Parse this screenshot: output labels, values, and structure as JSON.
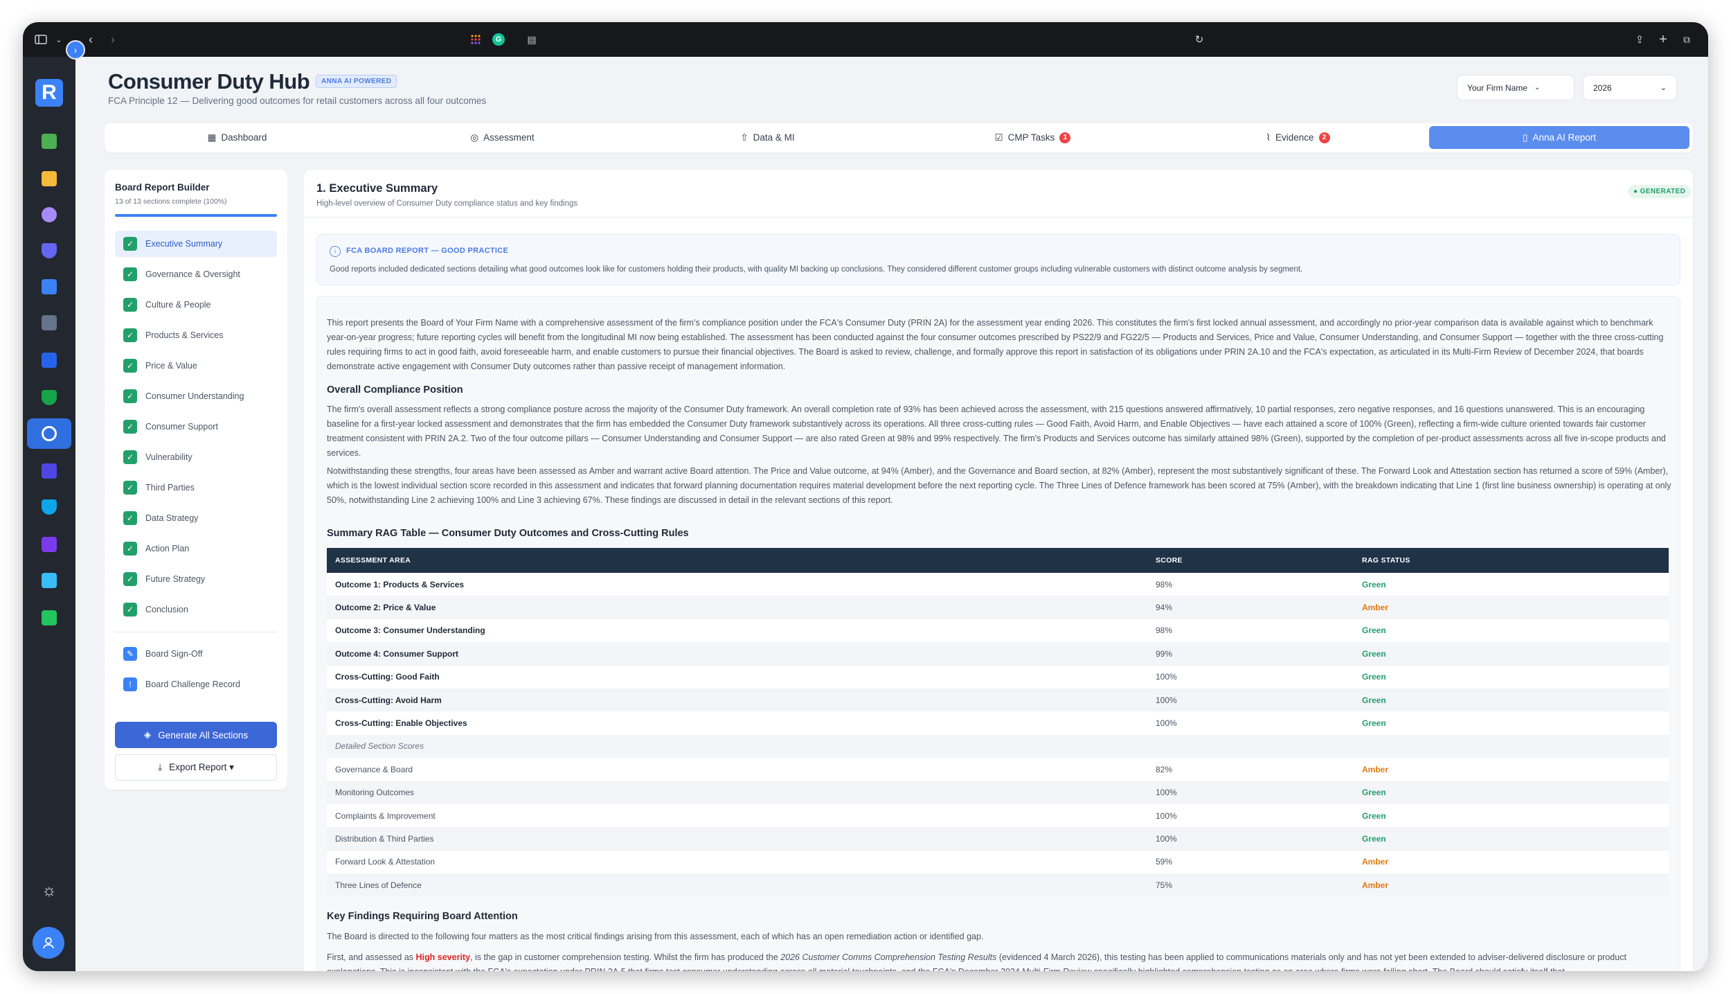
{
  "header": {
    "title": "Consumer Duty Hub",
    "badge": "ANNA AI POWERED",
    "subtitle": "FCA Principle 12 — Delivering good outcomes for retail customers across all four outcomes",
    "firm_select": "Your Firm Name",
    "year_select": "2026"
  },
  "tabs": [
    {
      "label": "Dashboard",
      "icon": "grid-icon"
    },
    {
      "label": "Assessment",
      "icon": "check-circle-icon"
    },
    {
      "label": "Data & MI",
      "icon": "upload-icon"
    },
    {
      "label": "CMP Tasks",
      "icon": "checkbox-icon",
      "badge": "1"
    },
    {
      "label": "Evidence",
      "icon": "paperclip-icon",
      "badge": "2"
    },
    {
      "label": "Anna AI Report",
      "icon": "document-icon"
    }
  ],
  "builder": {
    "title": "Board Report Builder",
    "progress": "13 of 13 sections complete (100%)",
    "progress_fraction": 1.0,
    "sections": [
      "Executive Summary",
      "Governance & Oversight",
      "Culture & People",
      "Products & Services",
      "Price & Value",
      "Consumer Understanding",
      "Consumer Support",
      "Vulnerability",
      "Third Parties",
      "Data Strategy",
      "Action Plan",
      "Future Strategy",
      "Conclusion"
    ],
    "extra": [
      {
        "label": "Board Sign-Off",
        "icon": "pen-icon"
      },
      {
        "label": "Board Challenge Record",
        "icon": "info-icon"
      }
    ],
    "generate_label": "Generate All Sections",
    "export_label": "Export Report ▾"
  },
  "report": {
    "title": "1. Executive Summary",
    "subtitle": "High-level overview of Consumer Duty compliance status and key findings",
    "status": "● GENERATED",
    "note_title": "FCA BOARD REPORT — GOOD PRACTICE",
    "note_body": "Good reports included dedicated sections detailing what good outcomes look like for customers holding their products, with quality MI backing up conclusions. They considered different customer groups including vulnerable customers with distinct outcome analysis by segment.",
    "intro": "This report presents the Board of Your Firm Name with a comprehensive assessment of the firm's compliance position under the FCA's Consumer Duty (PRIN 2A) for the assessment year ending 2026. This constitutes the firm's first locked annual assessment, and accordingly no prior-year comparison data is available against which to benchmark year-on-year progress; future reporting cycles will benefit from the longitudinal MI now being established. The assessment has been conducted against the four consumer outcomes prescribed by PS22/9 and FG22/5 — Products and Services, Price and Value, Consumer Understanding, and Consumer Support — together with the three cross-cutting rules requiring firms to act in good faith, avoid foreseeable harm, and enable customers to pursue their financial objectives. The Board is asked to review, challenge, and formally approve this report in satisfaction of its obligations under PRIN 2A.10 and the FCA's expectation, as articulated in its Multi-Firm Review of December 2024, that boards demonstrate active engagement with Consumer Duty outcomes rather than passive receipt of management information.",
    "h_overall": "Overall Compliance Position",
    "p_overall1": "The firm's overall assessment reflects a strong compliance posture across the majority of the Consumer Duty framework. An overall completion rate of 93% has been achieved across the assessment, with 215 questions answered affirmatively, 10 partial responses, zero negative responses, and 16 questions unanswered. This is an encouraging baseline for a first-year locked assessment and demonstrates that the firm has embedded the Consumer Duty framework substantively across its operations. All three cross-cutting rules — Good Faith, Avoid Harm, and Enable Objectives — have each attained a score of 100% (Green), reflecting a firm-wide culture oriented towards fair customer treatment consistent with PRIN 2A.2. Two of the four outcome pillars — Consumer Understanding and Consumer Support — are also rated Green at 98% and 99% respectively. The firm's Products and Services outcome has similarly attained 98% (Green), supported by the completion of per-product assessments across all five in-scope products and services.",
    "p_overall2": "Notwithstanding these strengths, four areas have been assessed as Amber and warrant active Board attention. The Price and Value outcome, at 94% (Amber), and the Governance and Board section, at 82% (Amber), represent the most substantively significant of these. The Forward Look and Attestation section has returned a score of 59% (Amber), which is the lowest individual section score recorded in this assessment and indicates that forward planning documentation requires material development before the next reporting cycle. The Three Lines of Defence framework has been scored at 75% (Amber), with the breakdown indicating that Line 1 (first line business ownership) is operating at only 50%, notwithstanding Line 2 achieving 100% and Line 3 achieving 67%. These findings are discussed in detail in the relevant sections of this report.",
    "h_table": "Summary RAG Table — Consumer Duty Outcomes and Cross-Cutting Rules",
    "table_headers": [
      "ASSESSMENT AREA",
      "SCORE",
      "RAG STATUS"
    ],
    "table_rows": [
      {
        "area": "Outcome 1: Products & Services",
        "score": "98%",
        "rag": "Green"
      },
      {
        "area": "Outcome 2: Price & Value",
        "score": "94%",
        "rag": "Amber"
      },
      {
        "area": "Outcome 3: Consumer Understanding",
        "score": "98%",
        "rag": "Green"
      },
      {
        "area": "Outcome 4: Consumer Support",
        "score": "99%",
        "rag": "Green"
      },
      {
        "area": "Cross-Cutting: Good Faith",
        "score": "100%",
        "rag": "Green"
      },
      {
        "area": "Cross-Cutting: Avoid Harm",
        "score": "100%",
        "rag": "Green"
      },
      {
        "area": "Cross-Cutting: Enable Objectives",
        "score": "100%",
        "rag": "Green"
      },
      {
        "area": "Detailed Section Scores",
        "score": "",
        "rag": ""
      },
      {
        "area": "Governance & Board",
        "score": "82%",
        "rag": "Amber"
      },
      {
        "area": "Monitoring Outcomes",
        "score": "100%",
        "rag": "Green"
      },
      {
        "area": "Complaints & Improvement",
        "score": "100%",
        "rag": "Green"
      },
      {
        "area": "Distribution & Third Parties",
        "score": "100%",
        "rag": "Green"
      },
      {
        "area": "Forward Look & Attestation",
        "score": "59%",
        "rag": "Amber"
      },
      {
        "area": "Three Lines of Defence",
        "score": "75%",
        "rag": "Amber"
      }
    ],
    "h_findings": "Key Findings Requiring Board Attention",
    "p_findings": "The Board is directed to the following four matters as the most critical findings arising from this assessment, each of which has an open remediation action or identified gap.",
    "p_first_a": "First, and assessed as ",
    "p_first_hl": "High severity",
    "p_first_b": ", is the gap in customer comprehension testing. Whilst the firm has produced the ",
    "p_first_it": "2026 Customer Comms Comprehension Testing Results",
    "p_first_c": " (evidenced 4 March 2026), this testing has been applied to communications materials only and has not yet been extended to adviser-delivered disclosure or product explanations. This is inconsistent with the FCA's expectation under PRIN 2A.5 that firms test consumer understanding across all material touchpoints, and the FCA's December 2024 Multi-Firm Review specifically highlighted comprehension testing as an area where firms were falling short. The Board should satisfy itself that"
  },
  "colors": {
    "accent": "#3b82f6",
    "green": "#22a06b",
    "amber": "#e07b12",
    "table_header": "#1f3246"
  }
}
